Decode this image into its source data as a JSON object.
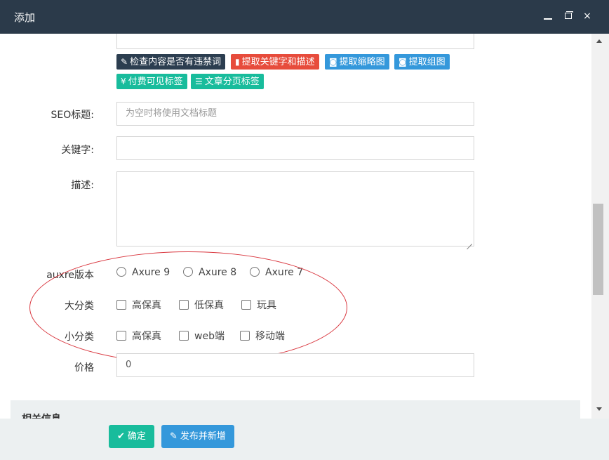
{
  "window": {
    "title": "添加",
    "controls": {
      "minimize": "minimize-icon",
      "maximize": "restore-icon",
      "close": "×"
    }
  },
  "toolbar": {
    "row1": [
      {
        "icon": "✎",
        "icon_name": "pencil-icon",
        "label": "检查内容是否有违禁词",
        "color": "#2c3e50"
      },
      {
        "icon": "▮",
        "icon_name": "file-icon",
        "label": "提取关键字和描述",
        "color": "#e74c3c"
      },
      {
        "icon": "◙",
        "icon_name": "camera-icon",
        "label": "提取缩略图",
        "color": "#3498db"
      },
      {
        "icon": "◙",
        "icon_name": "camera-icon",
        "label": "提取组图",
        "color": "#3498db"
      }
    ],
    "row2": [
      {
        "icon": "¥",
        "icon_name": "yen-icon",
        "label": "付费可见标签",
        "color": "#18bc9c"
      },
      {
        "icon": "☰",
        "icon_name": "list-icon",
        "label": "文章分页标签",
        "color": "#18bc9c"
      }
    ]
  },
  "form": {
    "seo_title": {
      "label": "SEO标题:",
      "value": "",
      "placeholder": "为空时将使用文档标题"
    },
    "keywords": {
      "label": "关键字:",
      "value": ""
    },
    "description": {
      "label": "描述:",
      "value": ""
    },
    "axure_version": {
      "label": "auxre版本",
      "options": [
        "Axure 9",
        "Axure 8",
        "Axure 7"
      ]
    },
    "category": {
      "label": "大分类",
      "options": [
        "高保真",
        "低保真",
        "玩具"
      ]
    },
    "subcategory": {
      "label": "小分类",
      "options": [
        "高保真",
        "web端",
        "移动端"
      ]
    },
    "price": {
      "label": "价格",
      "value": "0"
    }
  },
  "section": {
    "title": "相关信息"
  },
  "footer": {
    "confirm": {
      "icon": "✔",
      "label": "确定"
    },
    "publish": {
      "icon": "✎",
      "label": "发布并新增"
    }
  },
  "colors": {
    "titlebar": "#2b3a4a",
    "highlight_ellipse": "#d9363e",
    "success": "#18bc9c",
    "info": "#3498db",
    "danger": "#e74c3c",
    "dark": "#2c3e50"
  }
}
